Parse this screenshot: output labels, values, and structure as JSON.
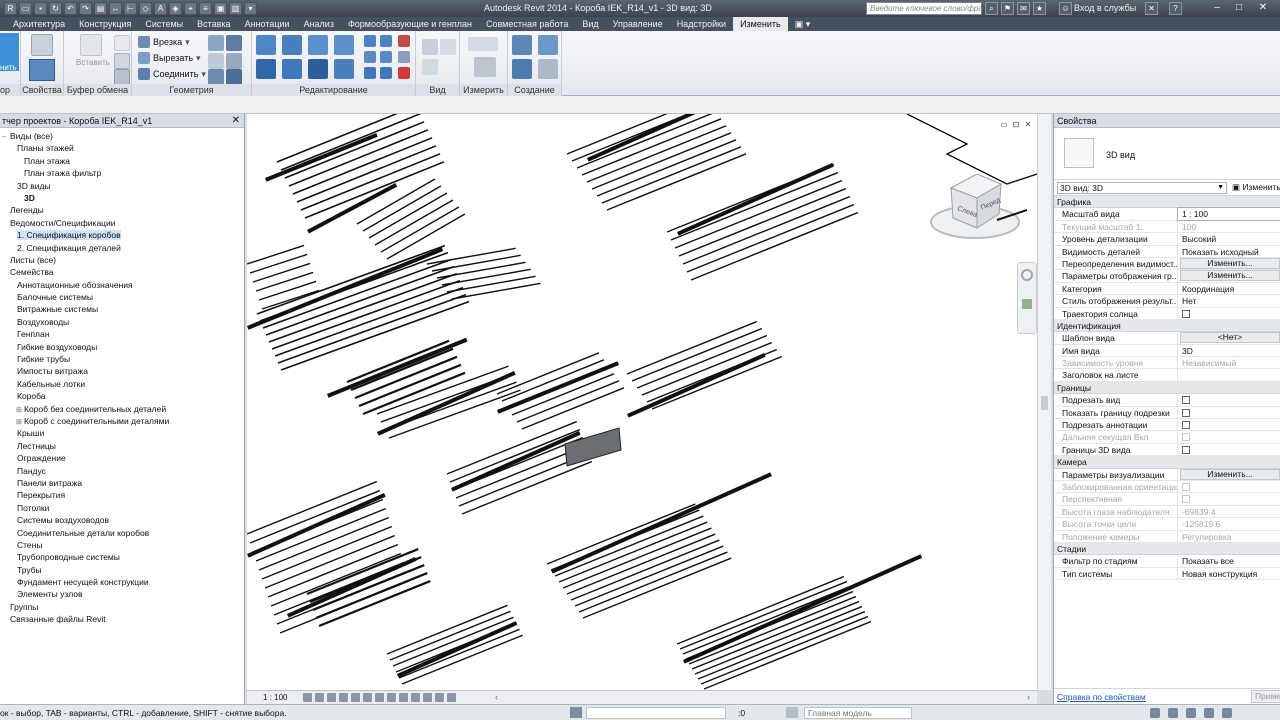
{
  "window": {
    "title": "Autodesk Revit 2014 -     Короба IEK_R14_v1 - 3D вид: 3D",
    "search_placeholder": "Введите ключевое слово/фразу",
    "sign_in": "Вход в службы"
  },
  "ribbon": {
    "tabs": [
      "Архитектура",
      "Конструкция",
      "Системы",
      "Вставка",
      "Аннотации",
      "Анализ",
      "Формообразующие и генплан",
      "Совместная работа",
      "Вид",
      "Управление",
      "Надстройки",
      "Изменить"
    ],
    "active_tab": "Изменить",
    "panels": {
      "modify_partial": "нить",
      "props": "Свойства",
      "clipboard": "Буфер обмена",
      "clipboard_paste": "Вставить",
      "geometry": "Геометрия",
      "geometry_cut": "Врезка",
      "geometry_trim": "Вырезать",
      "geometry_join": "Соединить",
      "edit": "Редактирование",
      "view": "Вид",
      "measure": "Измерить",
      "create": "Создание",
      "left_partial": "ор"
    }
  },
  "browser": {
    "title": "тчер проектов - Короба IEK_R14_v1",
    "nodes": [
      {
        "label": "Виды (все)",
        "indent": 0,
        "toggle": "−"
      },
      {
        "label": "Планы этажей",
        "indent": 1,
        "toggle": ""
      },
      {
        "label": "План этажа",
        "indent": 2,
        "toggle": ""
      },
      {
        "label": "План этажа фильтр",
        "indent": 2,
        "toggle": ""
      },
      {
        "label": "3D виды",
        "indent": 1,
        "toggle": ""
      },
      {
        "label": "3D",
        "indent": 2,
        "toggle": "",
        "bold": true
      },
      {
        "label": "Легенды",
        "indent": 0,
        "toggle": ""
      },
      {
        "label": "Ведомости/Спецификации",
        "indent": 0,
        "toggle": ""
      },
      {
        "label": "1. Спецификация коробов",
        "indent": 1,
        "toggle": "",
        "selected": true
      },
      {
        "label": "2. Спецификация деталей",
        "indent": 1,
        "toggle": ""
      },
      {
        "label": "Листы (все)",
        "indent": 0,
        "toggle": ""
      },
      {
        "label": "Семейства",
        "indent": 0,
        "toggle": ""
      },
      {
        "label": "Аннотационные обозначения",
        "indent": 1,
        "toggle": ""
      },
      {
        "label": "Балочные системы",
        "indent": 1,
        "toggle": ""
      },
      {
        "label": "Витражные системы",
        "indent": 1,
        "toggle": ""
      },
      {
        "label": "Воздуховоды",
        "indent": 1,
        "toggle": ""
      },
      {
        "label": "Генплан",
        "indent": 1,
        "toggle": ""
      },
      {
        "label": "Гибкие воздуховоды",
        "indent": 1,
        "toggle": ""
      },
      {
        "label": "Гибкие трубы",
        "indent": 1,
        "toggle": ""
      },
      {
        "label": "Импосты витража",
        "indent": 1,
        "toggle": ""
      },
      {
        "label": "Кабельные лотки",
        "indent": 1,
        "toggle": ""
      },
      {
        "label": "Короба",
        "indent": 1,
        "toggle": ""
      },
      {
        "label": "Короб без соединительных деталей",
        "indent": 2,
        "toggle": "⊞"
      },
      {
        "label": "Короб с соединительными деталями",
        "indent": 2,
        "toggle": "⊞"
      },
      {
        "label": "Крыши",
        "indent": 1,
        "toggle": ""
      },
      {
        "label": "Лестницы",
        "indent": 1,
        "toggle": ""
      },
      {
        "label": "Ограждение",
        "indent": 1,
        "toggle": ""
      },
      {
        "label": "Пандус",
        "indent": 1,
        "toggle": ""
      },
      {
        "label": "Панели витража",
        "indent": 1,
        "toggle": ""
      },
      {
        "label": "Перекрытия",
        "indent": 1,
        "toggle": ""
      },
      {
        "label": "Потолки",
        "indent": 1,
        "toggle": ""
      },
      {
        "label": "Системы воздуховодов",
        "indent": 1,
        "toggle": ""
      },
      {
        "label": "Соединительные детали коробов",
        "indent": 1,
        "toggle": ""
      },
      {
        "label": "Стены",
        "indent": 1,
        "toggle": ""
      },
      {
        "label": "Трубопроводные системы",
        "indent": 1,
        "toggle": ""
      },
      {
        "label": "Трубы",
        "indent": 1,
        "toggle": ""
      },
      {
        "label": "Фундамент несущей конструкции",
        "indent": 1,
        "toggle": ""
      },
      {
        "label": "Элементы узлов",
        "indent": 1,
        "toggle": ""
      },
      {
        "label": "Группы",
        "indent": 0,
        "toggle": ""
      },
      {
        "label": "Связанные файлы Revit",
        "indent": 0,
        "toggle": ""
      }
    ]
  },
  "viewport": {
    "scale": "1 : 100",
    "viewcube_front": "Перед",
    "viewcube_left": "Слева"
  },
  "properties": {
    "title": "Свойства",
    "type_name": "3D вид",
    "selector": "3D вид: 3D",
    "edit_type": "Изменить",
    "rows": [
      {
        "cat": "Графика"
      },
      {
        "k": "Масштаб вида",
        "v": "1 : 100",
        "kind": "input"
      },
      {
        "k": "Текущий масштаб    1:",
        "v": "100",
        "dim": true
      },
      {
        "k": "Уровень детализации",
        "v": "Высокий"
      },
      {
        "k": "Видимость деталей",
        "v": "Показать исходный"
      },
      {
        "k": "Переопределения видимост...",
        "v": "Изменить...",
        "kind": "button"
      },
      {
        "k": "Параметры отображения гр...",
        "v": "Изменить...",
        "kind": "button"
      },
      {
        "k": "Категория",
        "v": "Координация"
      },
      {
        "k": "Стиль отображения результ...",
        "v": "Нет"
      },
      {
        "k": "Траектория солнца",
        "v": "",
        "kind": "check"
      },
      {
        "cat": "Идентификация"
      },
      {
        "k": "Шаблон вида",
        "v": "<Нет>",
        "kind": "button"
      },
      {
        "k": "Имя вида",
        "v": "3D"
      },
      {
        "k": "Зависимость уровня",
        "v": "Независимый",
        "dim": true
      },
      {
        "k": "Заголовок на листе",
        "v": ""
      },
      {
        "cat": "Границы"
      },
      {
        "k": "Подрезать вид",
        "v": "",
        "kind": "check"
      },
      {
        "k": "Показать границу подрезки",
        "v": "",
        "kind": "check"
      },
      {
        "k": "Подрезать аннотации",
        "v": "",
        "kind": "check"
      },
      {
        "k": "Дальняя секущая Вкл",
        "v": "",
        "kind": "check",
        "dim": true
      },
      {
        "k": "Границы 3D вида",
        "v": "",
        "kind": "check"
      },
      {
        "cat": "Камера"
      },
      {
        "k": "Параметры визуализации",
        "v": "Изменить...",
        "kind": "button"
      },
      {
        "k": "Заблокированная ориентация",
        "v": "",
        "kind": "check",
        "dim": true
      },
      {
        "k": "Перспективная",
        "v": "",
        "kind": "check",
        "dim": true
      },
      {
        "k": "Высота глаза наблюдателя",
        "v": "-69839.4",
        "dim": true
      },
      {
        "k": "Высота точки цели",
        "v": "-125819.6",
        "dim": true
      },
      {
        "k": "Положение камеры",
        "v": "Регулировка",
        "dim": true
      },
      {
        "cat": "Стадии"
      },
      {
        "k": "Фильтр по стадиям",
        "v": "Показать все"
      },
      {
        "k": "Тип системы",
        "v": "Новая конструкция"
      }
    ],
    "help_link": "Справка по свойствам",
    "apply": "Приме"
  },
  "status": {
    "message": "ок - выбор, TAB - варианты, CTRL - добавление, SHIFT - снятие выбора.",
    "coord": ":0",
    "model": "Главная модель"
  },
  "colors": {
    "accent_tab": "#465160",
    "selection": "#cfe3fb",
    "link": "#1a56b0"
  }
}
